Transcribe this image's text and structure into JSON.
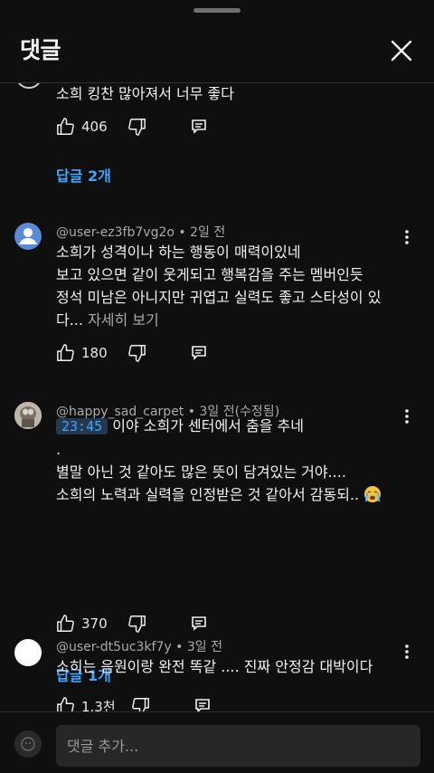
{
  "header": {
    "title": "댓글",
    "close_icon": "close-icon"
  },
  "partial": {
    "text": "소희 킹찬 많아져서 너무 좋다",
    "like_count": "406",
    "replies_label": "답글 2개"
  },
  "comments": [
    {
      "handle": "@user-ez3fb7vg2o",
      "sep": " • ",
      "time": "2일 전",
      "lines": [
        "소희가 성격이나 하는 행동이 매력이있네",
        "보고 있으면 같이 웃게되고 행복감을 주는 멤버인듯",
        "정석 미남은 아니지만 귀엽고 실력도 좋고 스타성이 있"
      ],
      "last_line": "다...",
      "more": " 자세히 보기",
      "like_count": "180",
      "avatar_color": "#5b8bd6"
    },
    {
      "handle": "@happy_sad_carpet",
      "sep": " • ",
      "time": "3일 전(수정됨)",
      "timestamp": "23:45",
      "first_line_rest": " 이야 소희가 센터에서 춤을 추네",
      "lines": [
        ".",
        "별말 아닌 것 같아도 많은 뜻이 담겨있는 거야....",
        "소희의 노력과 실력을 인정받은 것 같아서 감동되.. "
      ],
      "like_count": "370",
      "replies_label": "답글 1개",
      "emoji": "crying-face"
    },
    {
      "handle": "@user-dt5uc3kf7y",
      "sep": " • ",
      "time": "3일 전",
      "lines": [
        "소히는 음원이랑 완전 똑같 .... 진짜 안정감 대박이다"
      ],
      "like_count": "1.3천"
    }
  ],
  "footer": {
    "placeholder": "댓글 추가..."
  },
  "colors": {
    "background": "#0f0f0f",
    "link": "#3ea6ff",
    "muted": "#aaaaaa",
    "input_bg": "#272727"
  }
}
